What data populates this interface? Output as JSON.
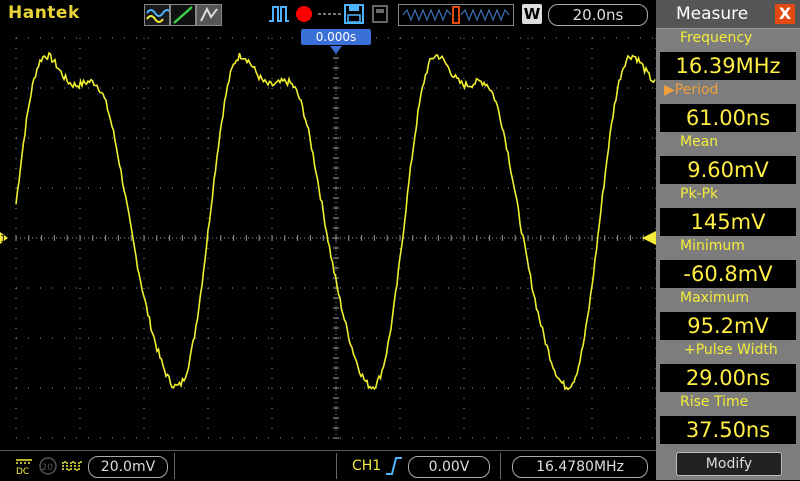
{
  "header": {
    "brand": "Hantek",
    "run_state_color": "#ff0000",
    "timebase": "20.0ns",
    "zoom_button": "W"
  },
  "scope": {
    "trigger_time_label": "0.000s",
    "channel_marker": "1",
    "trace_color": "#f0f030",
    "grid_color": "#9a9a9a"
  },
  "measure": {
    "title": "Measure",
    "close_label": "X",
    "items": [
      {
        "name": "Frequency",
        "value": "16.39MHz"
      },
      {
        "name": "Period",
        "value": "61.00ns"
      },
      {
        "name": "Mean",
        "value": "9.60mV"
      },
      {
        "name": "Pk-Pk",
        "value": "145mV"
      },
      {
        "name": "Minimum",
        "value": "-60.8mV"
      },
      {
        "name": "Maximum",
        "value": "95.2mV"
      },
      {
        "name": "+Pulse Width",
        "value": "29.00ns"
      },
      {
        "name": "Rise Time",
        "value": "37.50ns"
      }
    ],
    "selected_marker": "▶",
    "modify_label": "Modify"
  },
  "footer": {
    "coupling": "DC",
    "bw_limit": "20",
    "volts_div": "20.0mV",
    "trigger_channel": "CH1",
    "trigger_level": "0.00V",
    "frequency_counter": "16.4780MHz"
  }
}
